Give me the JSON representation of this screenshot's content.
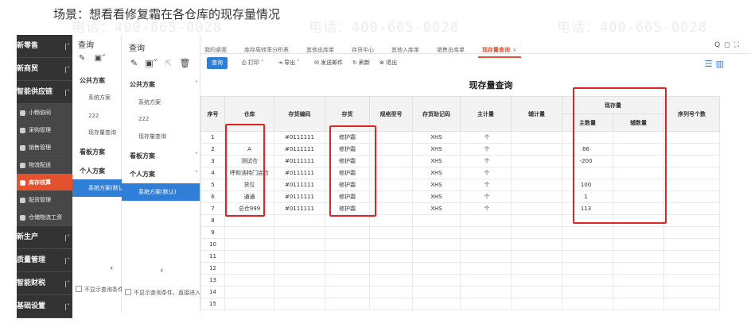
{
  "heading": "场景：想看看修复霜在各仓库的现存量情况",
  "watermark": {
    "phone": "电话：400-665-0028",
    "site": "网址：www.chanjet.net"
  },
  "nav": {
    "items": [
      {
        "label": "新零售",
        "kind": "group"
      },
      {
        "label": "新商贸",
        "kind": "group"
      },
      {
        "label": "智能供应链",
        "kind": "group"
      },
      {
        "label": "小畅协同",
        "kind": "sub"
      },
      {
        "label": "采购管理",
        "kind": "sub"
      },
      {
        "label": "销售管理",
        "kind": "sub"
      },
      {
        "label": "物流配送",
        "kind": "sub"
      },
      {
        "label": "库存核算",
        "kind": "sub",
        "active": true
      },
      {
        "label": "配货管理",
        "kind": "sub"
      },
      {
        "label": "仓储物流工资",
        "kind": "sub"
      },
      {
        "label": "新生产",
        "kind": "group"
      },
      {
        "label": "质量管理",
        "kind": "group"
      },
      {
        "label": "智能财税",
        "kind": "group"
      },
      {
        "label": "基础设置",
        "kind": "group"
      }
    ]
  },
  "panel1": {
    "title": "查询",
    "public_section": "公共方案",
    "public_items": [
      "系统方案",
      "222",
      "现存量查询"
    ],
    "board_section": "看板方案",
    "personal_section": "个人方案",
    "selected": "系统方案(默认)",
    "footer": "不显示查询条件"
  },
  "panel2": {
    "title": "查询",
    "public_section": "公共方案",
    "public_items": [
      "系统方案",
      "222",
      "现存量查询"
    ],
    "board_section": "看板方案",
    "personal_section": "个人方案",
    "selected": "系统方案(默认)",
    "footer": "不显示查询条件，直接进入"
  },
  "tabs": [
    {
      "label": "我的桌面"
    },
    {
      "label": "库存周转率分析表"
    },
    {
      "label": "其他出库单"
    },
    {
      "label": "存货中心"
    },
    {
      "label": "其他入库单"
    },
    {
      "label": "销售出库单"
    },
    {
      "label": "现存量查询",
      "active": true,
      "close": "×"
    }
  ],
  "window_controls": [
    "Q",
    "◻",
    "⛶"
  ],
  "toolbar": {
    "query": "查询",
    "print": "打印",
    "export": "导出",
    "email": "发送邮件",
    "refresh": "刷新",
    "exit": "退出"
  },
  "report": {
    "title": "现存量查询",
    "columns": {
      "seq": "序号",
      "warehouse": "仓库",
      "inv_code": "存货编码",
      "inventory": "存货",
      "spec": "规格型号",
      "mnemonic": "存货助记码",
      "main_unit": "主计量",
      "aux_unit": "辅计量",
      "stock_group": "现存量",
      "main_qty": "主数量",
      "aux_qty": "辅数量",
      "serial_count": "序列号个数"
    },
    "rows": [
      {
        "seq": "1",
        "warehouse": "",
        "inv_code": "#0111111",
        "inventory": "修护霜",
        "mnemonic": "XHS",
        "main_unit": "个",
        "main_qty": "",
        "neg": false
      },
      {
        "seq": "2",
        "warehouse": "A",
        "inv_code": "#0111111",
        "inventory": "修护霜",
        "mnemonic": "XHS",
        "main_unit": "个",
        "main_qty": "66",
        "neg": false
      },
      {
        "seq": "3",
        "warehouse": "测试仓",
        "inv_code": "#0111111",
        "inventory": "修护霜",
        "mnemonic": "XHS",
        "main_unit": "个",
        "main_qty": "-200",
        "neg": true
      },
      {
        "seq": "4",
        "warehouse": "呼和浩特门店仓",
        "inv_code": "#0111111",
        "inventory": "修护霜",
        "mnemonic": "XHS",
        "main_unit": "个",
        "main_qty": "",
        "neg": false
      },
      {
        "seq": "5",
        "warehouse": "货位",
        "inv_code": "#0111111",
        "inventory": "修护霜",
        "mnemonic": "XHS",
        "main_unit": "个",
        "main_qty": "100",
        "neg": false
      },
      {
        "seq": "6",
        "warehouse": "通通",
        "inv_code": "#0111111",
        "inventory": "修护霜",
        "mnemonic": "XHS",
        "main_unit": "个",
        "main_qty": "1",
        "neg": false
      },
      {
        "seq": "7",
        "warehouse": "总仓999",
        "inv_code": "#0111111",
        "inventory": "修护霜",
        "mnemonic": "XHS",
        "main_unit": "个",
        "main_qty": "113",
        "neg": false
      }
    ],
    "empty_rows": [
      "8",
      "9",
      "10",
      "11",
      "12",
      "13",
      "14",
      "15"
    ]
  }
}
